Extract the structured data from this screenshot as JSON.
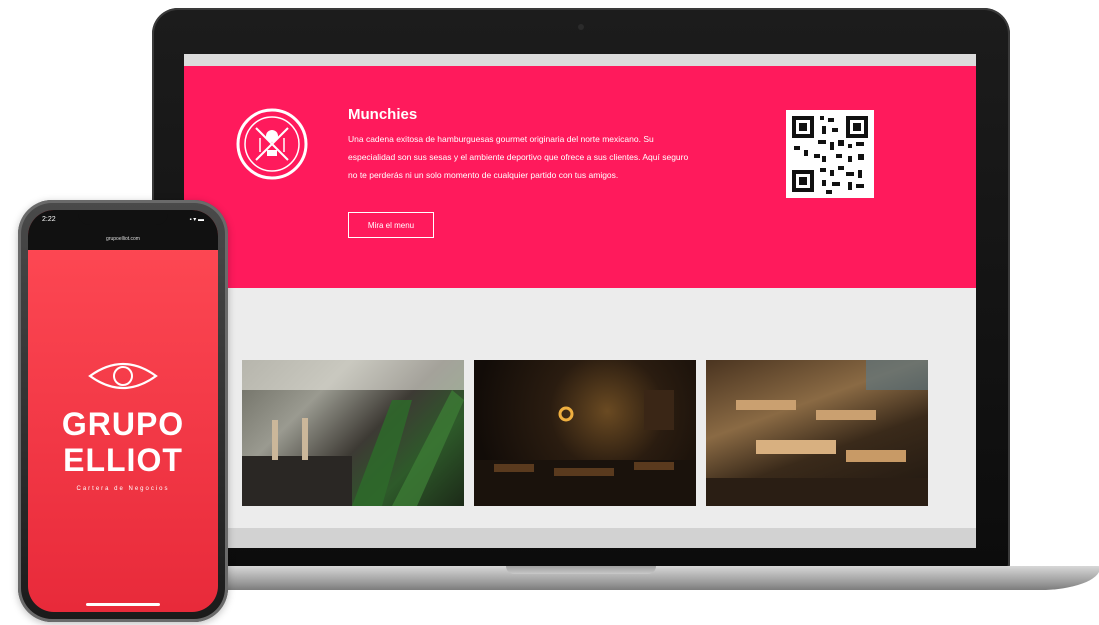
{
  "laptop": {
    "hero": {
      "title": "Munchies",
      "description": "Una cadena exitosa de hamburguesas gourmet originaria del norte mexicano. Su especialidad son sus sesas y el ambiente deportivo que ofrece a sus clientes. Aquí seguro no te perderás ni un solo momento de cualquier partido con tus amigos.",
      "button_label": "Mira el menu",
      "accent": "#ff1a5c"
    },
    "photos": [
      {
        "name": "restaurant-interior-plants"
      },
      {
        "name": "restaurant-interior-dark"
      },
      {
        "name": "restaurant-tables-wood"
      }
    ]
  },
  "phone": {
    "status": {
      "time": "2:22",
      "url": "grupoelliot.com",
      "signal": "▪ ▾ ▬"
    },
    "brand": {
      "line1": "GRUPO",
      "line2": "ELLIOT",
      "tagline": "Cartera de Negocios"
    },
    "accent": "#ee3344"
  }
}
